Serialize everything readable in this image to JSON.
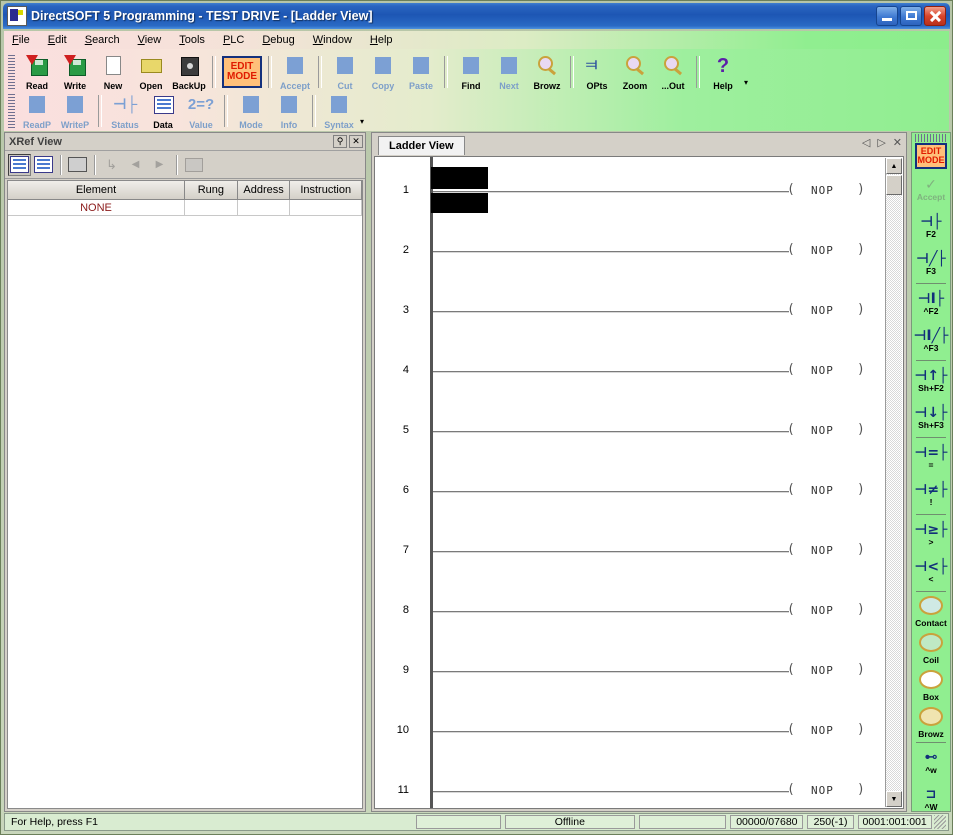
{
  "window": {
    "title": "DirectSOFT 5 Programming - TEST DRIVE - [Ladder View]",
    "icon": "app-icon",
    "minimize": "_",
    "maximize": "□",
    "close": "✕"
  },
  "menubar": {
    "items": [
      {
        "label": "File",
        "accel": "F"
      },
      {
        "label": "Edit",
        "accel": "E"
      },
      {
        "label": "Search",
        "accel": "S"
      },
      {
        "label": "View",
        "accel": "V"
      },
      {
        "label": "Tools",
        "accel": "T"
      },
      {
        "label": "PLC",
        "accel": "P"
      },
      {
        "label": "Debug",
        "accel": "D"
      },
      {
        "label": "Window",
        "accel": "W"
      },
      {
        "label": "Help",
        "accel": "H"
      }
    ]
  },
  "toolbar": {
    "row1": [
      {
        "label": "Read",
        "icon": "disk-read-icon",
        "enabled": true
      },
      {
        "label": "Write",
        "icon": "disk-write-icon",
        "enabled": true
      },
      {
        "label": "New",
        "icon": "new-document-icon",
        "enabled": true
      },
      {
        "label": "Open",
        "icon": "open-folder-icon",
        "enabled": true
      },
      {
        "label": "BackUp",
        "icon": "safe-backup-icon",
        "enabled": true
      },
      {
        "label": "EDIT MODE",
        "icon": "edit-mode-icon",
        "enabled": true
      },
      {
        "label": "Accept",
        "icon": "accept-check-icon",
        "enabled": false
      },
      {
        "label": "Cut",
        "icon": "scissors-icon",
        "enabled": false
      },
      {
        "label": "Copy",
        "icon": "copy-icon",
        "enabled": false
      },
      {
        "label": "Paste",
        "icon": "paste-icon",
        "enabled": false
      },
      {
        "label": "Find",
        "icon": "find-icon",
        "enabled": true
      },
      {
        "label": "Next",
        "icon": "next-icon",
        "enabled": false
      },
      {
        "label": "Browz",
        "icon": "browz-icon",
        "enabled": true
      },
      {
        "label": "OPts",
        "icon": "options-icon",
        "enabled": true
      },
      {
        "label": "Zoom",
        "icon": "zoom-in-icon",
        "enabled": true
      },
      {
        "label": "...Out",
        "icon": "zoom-out-icon",
        "enabled": true
      },
      {
        "label": "Help",
        "icon": "help-question-icon",
        "enabled": true
      }
    ],
    "row2": [
      {
        "label": "ReadP",
        "icon": "read-program-icon",
        "enabled": false
      },
      {
        "label": "WriteP",
        "icon": "write-program-icon",
        "enabled": false
      },
      {
        "label": "Status",
        "icon": "status-icon",
        "enabled": false
      },
      {
        "label": "Data",
        "icon": "data-view-icon",
        "enabled": true
      },
      {
        "label": "Value",
        "icon": "value-icon",
        "enabled": false
      },
      {
        "label": "Mode",
        "icon": "mode-icon",
        "enabled": false
      },
      {
        "label": "Info",
        "icon": "info-icon",
        "enabled": false
      },
      {
        "label": "Syntax",
        "icon": "syntax-icon",
        "enabled": false
      }
    ],
    "edit_mode_line1": "EDIT",
    "edit_mode_line2": "MODE",
    "dropdown_caret": "▾"
  },
  "xref": {
    "title": "XRef View",
    "pin_icon": "pin-icon",
    "close_icon": "close-icon",
    "tools": [
      {
        "name": "grid-view-toggle",
        "icon": "grid-small-icon",
        "enabled": true,
        "pressed": true
      },
      {
        "name": "list-view-toggle",
        "icon": "grid-large-icon",
        "enabled": true,
        "pressed": false
      },
      {
        "name": "print-button",
        "icon": "printer-icon",
        "enabled": true
      },
      {
        "name": "goto-button",
        "icon": "goto-arrow-icon",
        "enabled": false
      },
      {
        "name": "prev-button",
        "icon": "arrow-left-icon",
        "enabled": false
      },
      {
        "name": "next-button",
        "icon": "arrow-right-icon",
        "enabled": false
      },
      {
        "name": "stack-button",
        "icon": "stack-icon",
        "enabled": false
      }
    ],
    "columns": [
      "Element",
      "Rung",
      "Address",
      "Instruction"
    ],
    "rows": [
      {
        "element": "NONE",
        "rung": "",
        "address": "",
        "instruction": ""
      }
    ]
  },
  "ladder": {
    "tab_label": "Ladder View",
    "nav_prev": "◁",
    "nav_next": "▷",
    "nav_close": "✕",
    "coil_open": "(",
    "coil_close": ")",
    "rungs": [
      {
        "number": "1",
        "instruction": "NOP",
        "selected": true
      },
      {
        "number": "2",
        "instruction": "NOP",
        "selected": false
      },
      {
        "number": "3",
        "instruction": "NOP",
        "selected": false
      },
      {
        "number": "4",
        "instruction": "NOP",
        "selected": false
      },
      {
        "number": "5",
        "instruction": "NOP",
        "selected": false
      },
      {
        "number": "6",
        "instruction": "NOP",
        "selected": false
      },
      {
        "number": "7",
        "instruction": "NOP",
        "selected": false
      },
      {
        "number": "8",
        "instruction": "NOP",
        "selected": false
      },
      {
        "number": "9",
        "instruction": "NOP",
        "selected": false
      },
      {
        "number": "10",
        "instruction": "NOP",
        "selected": false
      },
      {
        "number": "11",
        "instruction": "NOP",
        "selected": false
      }
    ],
    "scroll_up": "▲",
    "scroll_down": "▼"
  },
  "sidebar": {
    "edit_mode_line1": "EDIT",
    "edit_mode_line2": "MODE",
    "accept_label": "Accept",
    "accept_icon": "accept-check-icon",
    "buttons": [
      {
        "symbol": "⊣├",
        "label": "F2",
        "icon": "contact-no-icon",
        "enabled": true
      },
      {
        "symbol": "⊣╱├",
        "label": "F3",
        "icon": "contact-nc-icon",
        "enabled": true
      },
      {
        "symbol": "⊣I├",
        "label": "^F2",
        "icon": "contact-immediate-icon",
        "enabled": true
      },
      {
        "symbol": "⊣I╱├",
        "label": "^F3",
        "icon": "contact-immediate-nc-icon",
        "enabled": true
      },
      {
        "symbol": "⊣↑├",
        "label": "Sh+F2",
        "icon": "contact-rising-edge-icon",
        "enabled": true
      },
      {
        "symbol": "⊣↓├",
        "label": "Sh+F3",
        "icon": "contact-falling-edge-icon",
        "enabled": true
      },
      {
        "symbol": "⊣=├",
        "label": "=",
        "icon": "compare-equal-icon",
        "enabled": true
      },
      {
        "symbol": "⊣≠├",
        "label": "!",
        "icon": "compare-notequal-icon",
        "enabled": true
      },
      {
        "symbol": "⊣≥├",
        "label": ">",
        "icon": "compare-greater-icon",
        "enabled": true
      },
      {
        "symbol": "⊣<├",
        "label": "<",
        "icon": "compare-less-icon",
        "enabled": true
      },
      {
        "symbol": "",
        "label": "Contact",
        "icon": "contact-tool-icon",
        "enabled": true
      },
      {
        "symbol": "",
        "label": "Coil",
        "icon": "coil-tool-icon",
        "enabled": true
      },
      {
        "symbol": "",
        "label": "Box",
        "icon": "box-tool-icon",
        "enabled": true
      },
      {
        "symbol": "",
        "label": "Browz",
        "icon": "browz-tool-icon",
        "enabled": true
      },
      {
        "symbol": "",
        "label": "^w",
        "icon": "wire-vertical-icon",
        "enabled": true
      },
      {
        "symbol": "",
        "label": "^W",
        "icon": "wire-horizontal-icon",
        "enabled": true
      }
    ],
    "scroll_left": "◂"
  },
  "statusbar": {
    "help_text": "For Help, press F1",
    "cell_blank1": "",
    "connection": "Offline",
    "cell_blank2": "",
    "memory": "00000/07680",
    "scan": "250(-1)",
    "position": "0001:001:001"
  },
  "colors": {
    "titlebar_blue": "#1d56b4",
    "toolbar_pink": "#fadede",
    "toolbar_green": "#90ee90",
    "edit_mode_bg": "#ffc07a",
    "edit_mode_text": "#e01b00",
    "edit_mode_border": "#13307d",
    "none_text": "#8b1a1a",
    "sidebar_green": "#90ee90",
    "symbol_navy": "#12307a",
    "statusbar_bg": "#d9ecd1"
  }
}
